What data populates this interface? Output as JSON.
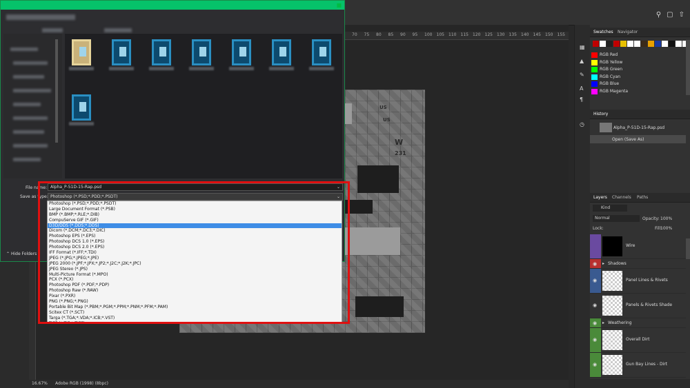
{
  "topbar": {
    "icons": [
      "search-icon",
      "workspace-icon",
      "share-icon"
    ]
  },
  "ruler": {
    "ticks": [
      "70",
      "75",
      "80",
      "85",
      "90",
      "95",
      "100",
      "105",
      "110",
      "115",
      "120",
      "125",
      "130",
      "135",
      "140",
      "145",
      "150",
      "155"
    ]
  },
  "texture": {
    "marks": [
      "W",
      "231",
      "US",
      "US"
    ]
  },
  "status": {
    "zoom": "16.67%",
    "profile": "Adobe RGB (1998) (8bpc)"
  },
  "dialog": {
    "file_name_label": "File name:",
    "file_name_value": "Alpha_P-51D-15-Rap.psd",
    "save_type_label": "Save as type:",
    "save_type_value": "Photoshop (*.PSD;*.PDD;*.PSDT)",
    "hide_folders": "Hide Folders",
    "type_options": [
      "Photoshop (*.PSD;*.PDD;*.PSDT)",
      "Large Document Format (*.PSB)",
      "BMP (*.BMP;*.RLE;*.DIB)",
      "CompuServe GIF (*.GIF)",
      "D3D/DDS (*.DDS;*.DDS)",
      "Dicom (*.DCM;*.DC3;*.DIC)",
      "Photoshop EPS (*.EPS)",
      "Photoshop DCS 1.0 (*.EPS)",
      "Photoshop DCS 2.0 (*.EPS)",
      "IFF Format (*.IFF;*.TDI)",
      "JPEG (*.JPG;*.JPEG;*.JPE)",
      "JPEG 2000 (*.JPF;*.JPX;*.JP2;*.J2C;*.J2K;*.JPC)",
      "JPEG Stereo (*.JPS)",
      "Multi-Picture Format (*.MPO)",
      "PCX (*.PCX)",
      "Photoshop PDF (*.PDF;*.PDP)",
      "Photoshop Raw (*.RAW)",
      "Pixar (*.PXR)",
      "PNG (*.PNG;*.PNG)",
      "Portable Bit Map (*.PBM;*.PGM;*.PPM;*.PNM;*.PFM;*.PAM)",
      "Scitex CT (*.SCT)",
      "Targa (*.TGA;*.VDA;*.ICB;*.VST)",
      "TIFF (*.TIF;*.TIFF)"
    ],
    "selected_index": 4
  },
  "swatches": {
    "tabs": [
      "Swatches",
      "Navigator"
    ],
    "colors": [
      "#c00000",
      "#ffffff",
      "#222222",
      "#c00000",
      "#e8c000",
      "#ffffff",
      "#ffffff",
      "#3a2a1a",
      "#e8a000",
      "#1a3aa0",
      "#ffffff",
      "#111111",
      "#ffffff",
      "#ffffff"
    ],
    "named": [
      {
        "name": "RGB Red",
        "color": "#ff0000"
      },
      {
        "name": "RGB Yellow",
        "color": "#ffff00"
      },
      {
        "name": "RGB Green",
        "color": "#00ff00"
      },
      {
        "name": "RGB Cyan",
        "color": "#00ffff"
      },
      {
        "name": "RGB Blue",
        "color": "#0000ff"
      },
      {
        "name": "RGB Magenta",
        "color": "#ff00ff"
      }
    ]
  },
  "history": {
    "title": "History",
    "snapshot": "Alpha_P-51D-15-Rap.psd",
    "step": "Open (Save As)"
  },
  "layers": {
    "tabs": [
      "Layers",
      "Channels",
      "Paths"
    ],
    "kind": "Kind",
    "blend": "Normal",
    "opacity_label": "Opacity:",
    "opacity": "100%",
    "lock_label": "Lock:",
    "fill_label": "Fill:",
    "fill": "100%",
    "items": [
      {
        "name": "Wire",
        "type": "layer",
        "color": "#6a4aa0"
      },
      {
        "name": "Shadows",
        "type": "group",
        "color": "#b83030"
      },
      {
        "name": "Panel Lines & Rivets",
        "type": "layer",
        "color": "#3a5a90"
      },
      {
        "name": "Panels & Rivets Shade",
        "type": "layer",
        "color": "#323232"
      },
      {
        "name": "Weathering",
        "type": "group",
        "color": "#4a8a3a"
      },
      {
        "name": "Overall Dirt",
        "type": "layer",
        "color": "#4a8a3a"
      },
      {
        "name": "Gun Bay Lines - Dirt",
        "type": "layer",
        "color": "#4a8a3a"
      }
    ]
  }
}
